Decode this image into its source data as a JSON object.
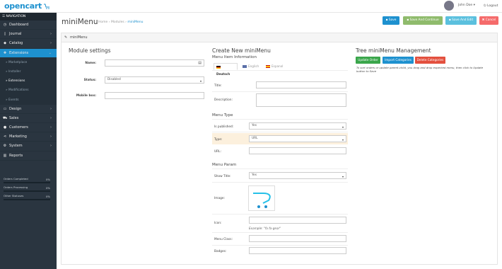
{
  "topbar": {
    "logo_text": "opencart",
    "user_name": "John Doe ▾",
    "logout_label": "Logout"
  },
  "sidebar": {
    "header": "NAVIGATION",
    "items": [
      {
        "label": "Dashboard",
        "icon": "dashboard-icon"
      },
      {
        "label": "Journal",
        "icon": "journal-icon"
      },
      {
        "label": "Catalog",
        "icon": "tag-icon"
      },
      {
        "label": "Extensions",
        "icon": "puzzle-icon"
      }
    ],
    "subitems": [
      "Marketplace",
      "Installer",
      "Extensions",
      "Modifications",
      "Events"
    ],
    "items2": [
      {
        "label": "Design",
        "icon": "monitor-icon"
      },
      {
        "label": "Sales",
        "icon": "cart-icon"
      },
      {
        "label": "Customers",
        "icon": "user-icon"
      },
      {
        "label": "Marketing",
        "icon": "share-icon"
      },
      {
        "label": "System",
        "icon": "cog-icon"
      },
      {
        "label": "Reports",
        "icon": "bar-chart-icon"
      }
    ],
    "stats": [
      {
        "label": "Orders Completed",
        "percent": "0%",
        "value": 0
      },
      {
        "label": "Orders Processing",
        "percent": "0%",
        "value": 0
      },
      {
        "label": "Other Statuses",
        "percent": "0%",
        "value": 0
      }
    ]
  },
  "header": {
    "title": "miniMenu",
    "breadcrumb": [
      "Home",
      "Modules",
      "miniMenu"
    ],
    "buttons": {
      "save": "Save",
      "save_continue": "Save And Continue",
      "save_edit": "Save And Edit",
      "cancel": "Cancel"
    }
  },
  "panel": {
    "title": "miniMenu"
  },
  "module_settings": {
    "heading": "Module settings",
    "name_label": "Name:",
    "status_label": "Status:",
    "status_value": "Disabled",
    "mobile_label": "Mobile box:"
  },
  "create": {
    "heading": "Create New miniMenu",
    "info_heading": "Menu Item Information",
    "tabs": [
      "Deutsch",
      "English",
      "Espanol"
    ],
    "title_label": "Title:",
    "description_label": "Description:",
    "type_heading": "Menu Type",
    "published_label": "Is published:",
    "published_value": "Yes",
    "type_label": "Type:",
    "type_value": "URL",
    "url_label": "URL:",
    "param_heading": "Menu Param",
    "show_title_label": "Show Title:",
    "show_title_value": "Yes",
    "image_label": "Image:",
    "icon_label": "Icon:",
    "icon_example": "Example: \"fa fa-gear\"",
    "menu_class_label": "Menu Class:",
    "badges_label": "Badges:"
  },
  "tree": {
    "heading": "Tree miniMenu Management",
    "buttons": [
      "Update Order",
      "Import Categories",
      "Delete Categories"
    ],
    "hint": "To sort orders or update parent-child, you drag and drop expected menu, then click to Update button to Save"
  },
  "colors": {
    "sidebar_bg": "#2a3540",
    "active": "#1e91cf",
    "save_blue": "#1e91cf",
    "save_green": "#8fbb6c",
    "save_lightblue": "#5bc0de",
    "danger": "#f56b6b"
  }
}
